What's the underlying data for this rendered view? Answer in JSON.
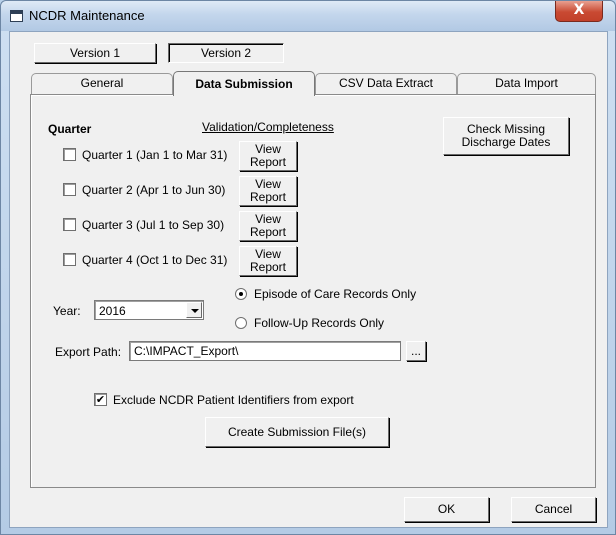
{
  "window": {
    "title": "NCDR Maintenance",
    "close_glyph": "X"
  },
  "versions": {
    "v1": "Version 1",
    "v2": "Version 2"
  },
  "tabs": [
    {
      "label": "General"
    },
    {
      "label": "Data Submission"
    },
    {
      "label": "CSV Data Extract"
    },
    {
      "label": "Data Import"
    }
  ],
  "submission": {
    "quarter_heading": "Quarter",
    "validation_heading": "Validation/Completeness",
    "check_missing_button": "Check Missing\nDischarge Dates",
    "quarters": [
      {
        "label": "Quarter 1 (Jan 1 to Mar 31)",
        "checked": false,
        "report_button": "View\nReport"
      },
      {
        "label": "Quarter 2 (Apr 1 to Jun 30)",
        "checked": false,
        "report_button": "View\nReport"
      },
      {
        "label": "Quarter 3 (Jul 1 to Sep 30)",
        "checked": false,
        "report_button": "View\nReport"
      },
      {
        "label": "Quarter 4 (Oct 1 to Dec 31)",
        "checked": false,
        "report_button": "View\nReport"
      }
    ],
    "year_label": "Year:",
    "year_value": "2016",
    "radio_episode": "Episode of Care Records Only",
    "radio_followup": "Follow-Up Records Only",
    "export_path_label": "Export Path:",
    "export_path_value": "C:\\IMPACT_Export\\",
    "browse_button": "...",
    "exclude_label": "Exclude NCDR Patient Identifiers from export",
    "exclude_checked": true,
    "create_button": "Create Submission File(s)"
  },
  "footer": {
    "ok_button": "OK",
    "cancel_button": "Cancel"
  }
}
